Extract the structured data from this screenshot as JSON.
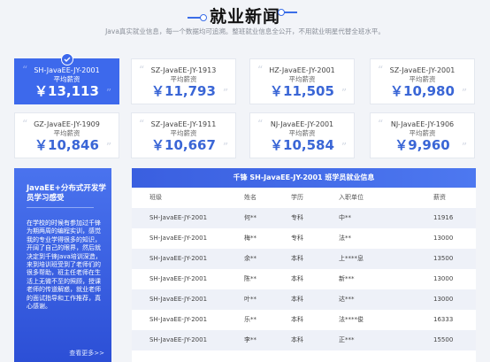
{
  "header": {
    "title": "就业新闻",
    "subtitle": "Java真实就业信息，每一个数据均可追溯。整班就业信息全公开，不用就业明星代替全班水平。"
  },
  "cards": [
    {
      "cls": "SH-JavaEE-JY-2001",
      "label": "平均薪资",
      "salary": "￥13,113",
      "active": true
    },
    {
      "cls": "SZ-JavaEE-JY-1913",
      "label": "平均薪资",
      "salary": "￥11,793"
    },
    {
      "cls": "HZ-JavaEE-JY-2001",
      "label": "平均薪资",
      "salary": "￥11,505"
    },
    {
      "cls": "SZ-JavaEE-JY-2001",
      "label": "平均薪资",
      "salary": "￥10,980"
    },
    {
      "cls": "GZ-JavaEE-JY-1909",
      "label": "平均薪资",
      "salary": "￥10,846"
    },
    {
      "cls": "SZ-JavaEE-JY-1911",
      "label": "平均薪资",
      "salary": "￥10,667"
    },
    {
      "cls": "NJ-JavaEE-JY-2001",
      "label": "平均薪资",
      "salary": "￥10,584"
    },
    {
      "cls": "NJ-JavaEE-JY-1906",
      "label": "平均薪资",
      "salary": "￥9,960"
    }
  ],
  "sidebar": {
    "title": "JavaEE+分布式开发学员学习感受",
    "text": "在学校的时候有参加过千锋为期两周的编程实训，感觉我的专业学得很多的知识，开阔了自己的眼界，然后就决定到千锋Java培训深造，来到培训班受到了老师们的很多帮助，班主任老师在生活上无微不至的照顾，授课老师的传道解惑，就业老师的面试指导和工作推荐，真心感谢。",
    "more": "查看更多>>"
  },
  "table": {
    "caption": "千锋 SH-JavaEE-JY-2001 班学员就业信息",
    "columns": [
      "班级",
      "姓名",
      "学历",
      "入职单位",
      "薪资"
    ],
    "rows": [
      [
        "SH-JavaEE-JY-2001",
        "何**",
        "专科",
        "中**",
        "11916"
      ],
      [
        "SH-JavaEE-JY-2001",
        "梅**",
        "专科",
        "法**",
        "13000"
      ],
      [
        "SH-JavaEE-JY-2001",
        "余**",
        "本科",
        "上****息",
        "13500"
      ],
      [
        "SH-JavaEE-JY-2001",
        "陈**",
        "本科",
        "新***",
        "13000"
      ],
      [
        "SH-JavaEE-JY-2001",
        "叶**",
        "本科",
        "达***",
        "13000"
      ],
      [
        "SH-JavaEE-JY-2001",
        "乐**",
        "本科",
        "法****俊",
        "16333"
      ],
      [
        "SH-JavaEE-JY-2001",
        "李**",
        "本科",
        "正***",
        "15500"
      ]
    ]
  },
  "colors": {
    "accent": "#3d69ec",
    "salary": "#3a66d6",
    "background": "#f2f4f8"
  }
}
